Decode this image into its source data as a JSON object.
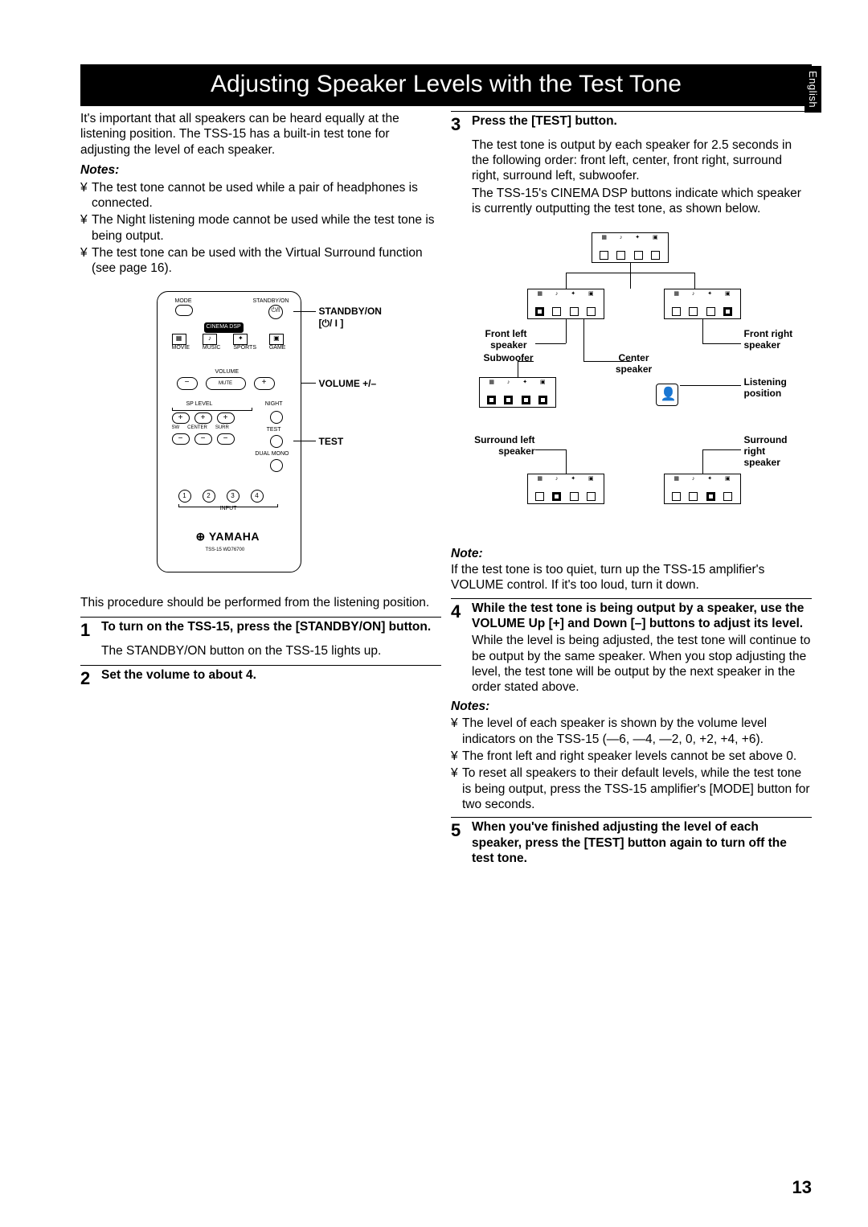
{
  "language_tab": "English",
  "title": "Adjusting Speaker Levels with the Test Tone",
  "page_number": "13",
  "left": {
    "intro": "It's important that all speakers can be heard equally at the listening position. The TSS-15 has a built-in test tone for adjusting the level of each speaker.",
    "notes_head": "Notes:",
    "notes": [
      "The test tone cannot be used while a pair of headphones is connected.",
      "The Night listening mode cannot be used while the test tone is being output.",
      "The test tone can be used with the Virtual Surround function (see page 16)."
    ],
    "remote": {
      "mode": "MODE",
      "standby": "STANDBY/ON",
      "cinema": "CINEMA DSP",
      "dsp_labels": [
        "MOVIE",
        "MUSIC",
        "SPORTS",
        "GAME"
      ],
      "volume": "VOLUME",
      "mute": "MUTE",
      "splevel": "SP LEVEL",
      "night": "NIGHT",
      "sw": "SW",
      "center": "CENTER",
      "surr": "SURR",
      "test": "TEST",
      "dualmono": "DUAL MONO",
      "input": "INPUT",
      "yamaha": "YAMAHA",
      "model": "TSS-15 WD76700",
      "callouts": {
        "standby": "STANDBY/ON [⏻/ I ]",
        "volume": "VOLUME +/–",
        "test": "TEST"
      }
    },
    "proc_intro": "This procedure should be performed from the listening position.",
    "steps": {
      "s1n": "1",
      "s1h": "To turn on the TSS-15, press the [STANDBY/ON] button.",
      "s1b": "The STANDBY/ON button on the TSS-15 lights up.",
      "s2n": "2",
      "s2h": "Set the volume to about 4."
    }
  },
  "right": {
    "s3n": "3",
    "s3h": "Press the [TEST] button.",
    "s3b1": "The test tone is output by each speaker for 2.5 seconds in the following order: front left, center, front right, surround right, surround left, subwoofer.",
    "s3b2": "The TSS-15's CINEMA DSP buttons indicate which speaker is currently outputting the test tone, as shown below.",
    "fig": {
      "front_left": "Front left speaker",
      "front_right": "Front right speaker",
      "subwoofer": "Subwoofer",
      "center": "Center speaker",
      "listening": "Listening position",
      "surr_left": "Surround left speaker",
      "surr_right": "Surround right speaker",
      "icons": [
        "MOVIE",
        "MUSIC",
        "SPORTS",
        "GAME"
      ]
    },
    "note_head": "Note:",
    "note_body": "If the test tone is too quiet, turn up the TSS-15 amplifier's VOLUME control. If it's too loud, turn it down.",
    "s4n": "4",
    "s4h": "While the test tone is being output by a speaker, use the VOLUME Up [+] and Down [–] buttons to adjust its level.",
    "s4b": "While the level is being adjusted, the test tone will continue to be output by the same speaker. When you stop adjusting the level, the test tone will be output by the next speaker in the order stated above.",
    "notes2_head": "Notes:",
    "notes2": [
      "The level of each speaker is shown by the volume level indicators on the TSS-15 (—6, —4, —2, 0, +2, +4, +6).",
      "The front left and right speaker levels cannot be set above 0.",
      "To reset all speakers to their default levels, while the test tone is being output, press the TSS-15 amplifier's [MODE] button for two seconds."
    ],
    "s5n": "5",
    "s5h": "When you've finished adjusting the level of each speaker, press the [TEST] button again to turn off the test tone."
  }
}
